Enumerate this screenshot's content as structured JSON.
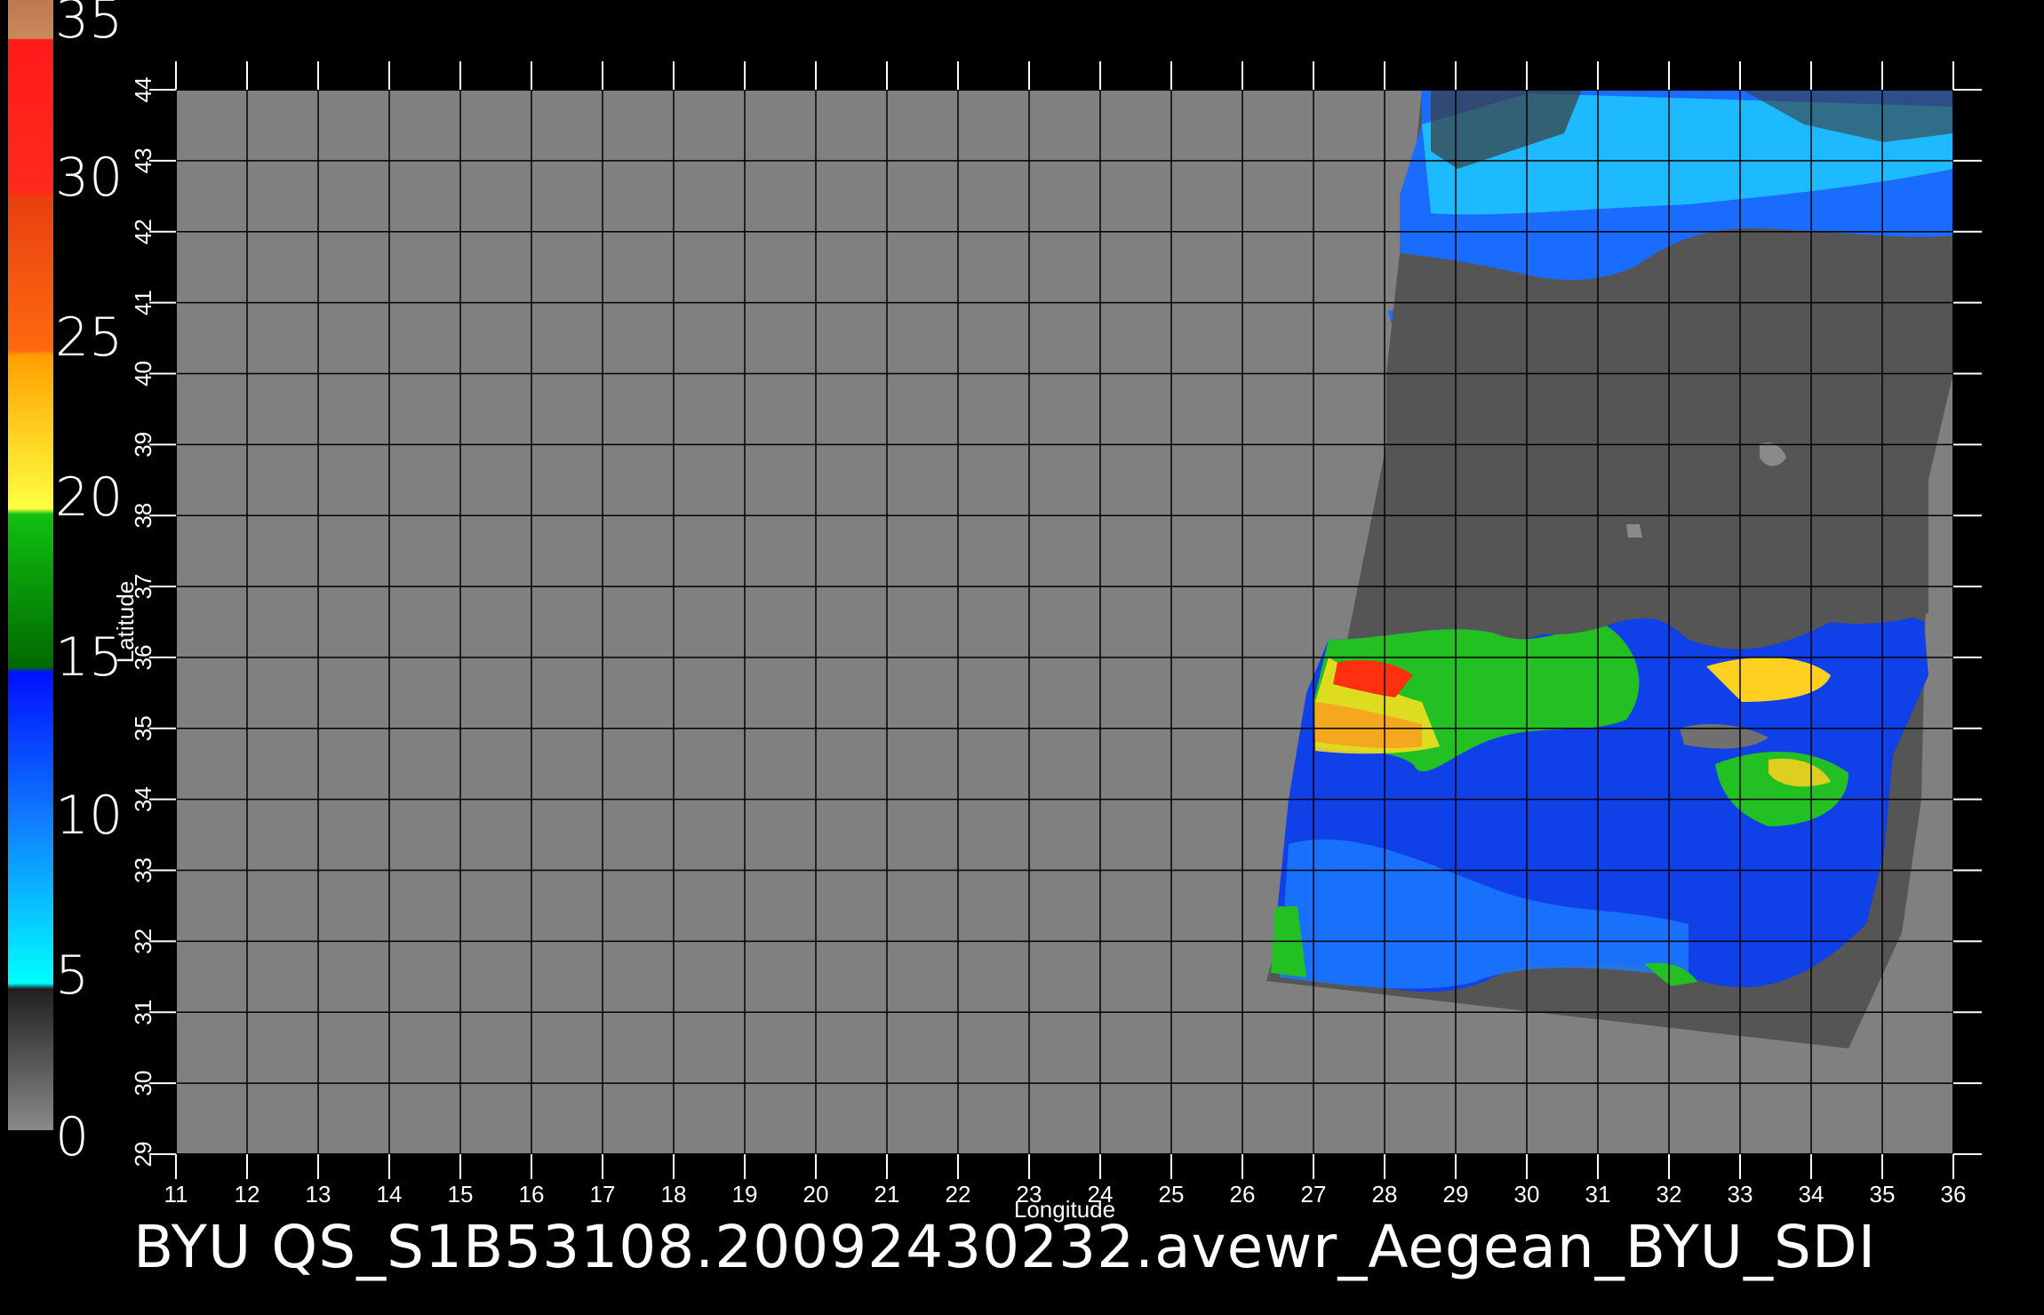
{
  "colorbar": {
    "labels": [
      "35",
      "30",
      "25",
      "20",
      "15",
      "10",
      "5",
      "0"
    ],
    "stops": [
      {
        "color": "#c88a5a"
      },
      {
        "color": "#ff2a1a"
      },
      {
        "color": "#ff5a10"
      },
      {
        "color": "#ffb400"
      },
      {
        "color": "#ffff40"
      },
      {
        "color": "#22cc22"
      },
      {
        "color": "#1040ff"
      },
      {
        "color": "#20c8ff"
      },
      {
        "color": "#00ffff"
      },
      {
        "color": "#333333"
      },
      {
        "color": "#777777"
      }
    ]
  },
  "map": {
    "xlabel": "Longitude",
    "ylabel": "Latitude",
    "lon_ticks": [
      "11",
      "12",
      "13",
      "14",
      "15",
      "16",
      "17",
      "18",
      "19",
      "20",
      "21",
      "22",
      "23",
      "24",
      "25",
      "26",
      "27",
      "28",
      "29",
      "30",
      "31",
      "32",
      "33",
      "34",
      "35",
      "36"
    ],
    "lat_ticks": [
      "29",
      "30",
      "31",
      "32",
      "33",
      "34",
      "35",
      "36",
      "37",
      "38",
      "39",
      "40",
      "41",
      "42",
      "43",
      "44"
    ],
    "background_color": "#808080",
    "land_color": "#555555",
    "grid": true
  },
  "footer": {
    "title": "BYU QS_S1B53108.20092430232.avewr_Aegean_BYU_SDI"
  }
}
